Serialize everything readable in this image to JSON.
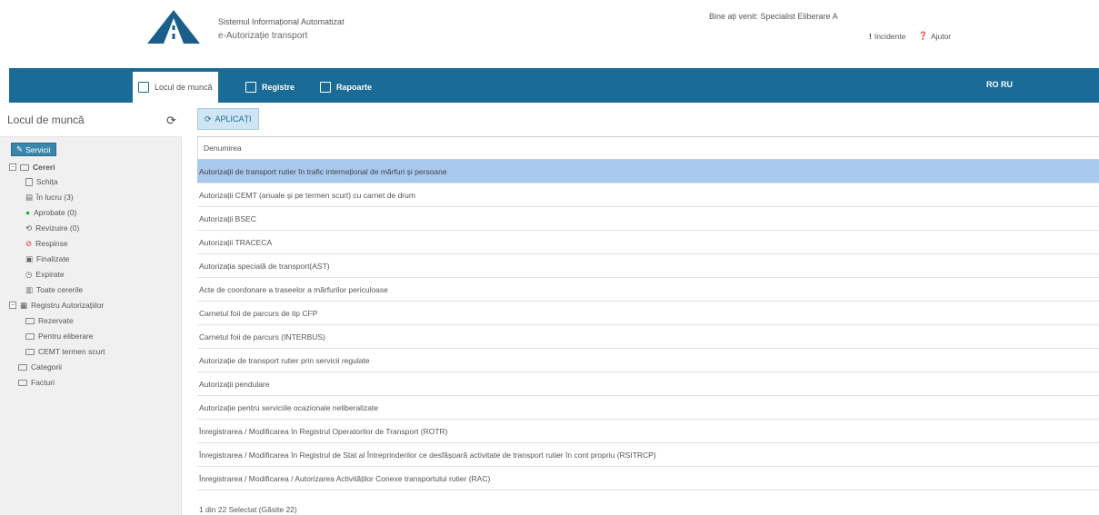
{
  "header": {
    "system_line1": "Sistemul Informațional Automatizat",
    "system_line2": "e-Autorizație transport",
    "welcome": "Bine ați venit: Specialist Eliberare A",
    "incidents": "Incidente",
    "help": "Ajutor"
  },
  "nav": {
    "work": "Locul de muncă",
    "registers": "Registre",
    "reports": "Rapoarte",
    "lang": "RO RU"
  },
  "sidebar": {
    "title": "Locul de muncă",
    "servicii": "Servicii",
    "cereri": "Cereri",
    "schita": "Schița",
    "in_lucru": "În lucru (3)",
    "aprobate": "Aprobate (0)",
    "revizuire": "Revizuire (0)",
    "respinse": "Respinse",
    "finalizate": "Finalizate",
    "expirate": "Expirate",
    "toate": "Toate cererile",
    "registru": "Registru Autorizațiilor",
    "rezervate": "Rezervate",
    "pentru_eliberare": "Pentru eliberare",
    "cemt": "CEMT termen scurt",
    "categorii": "Categorii",
    "facturi": "Facturi"
  },
  "main": {
    "apl_button": "APLICAȚI",
    "column": "Denumirea",
    "rows": [
      "Autorizații de transport rutier în trafic internațional de mărfuri și persoane",
      "Autorizații CEMT (anuale și pe termen scurt) cu carnet de drum",
      "Autorizații BSEC",
      "Autorizații TRACECA",
      "Autorizația specială de transport(AST)",
      "Acte de coordonare a traseelor a mărfurilor periculoase",
      "Carnetul foii de parcurs de tip CFP",
      "Carnetul foii de parcurs (INTERBUS)",
      "Autorizație de transport rutier prin servicii regulate",
      "Autorizații pendulare",
      "Autorizație pentru serviciile ocazionale neliberalizate",
      "Înregistrarea / Modificarea în Registrul Operatorilor de Transport (ROTR)",
      "Înregistrarea / Modificarea în Registrul de Stat al Întreprinderilor ce desfășoară activitate de transport rutier în cont propriu (RSITRCP)",
      "Înregistrarea / Modificarea / Autorizarea Activităților Conexe transportului rutier (RAC)"
    ],
    "footer": "1 din 22 Selectat (Găsite 22)"
  },
  "colors": {
    "nav": "#1a6b95",
    "selected_row": "#a9c8ee",
    "servicii_btn": "#3a87ad"
  }
}
